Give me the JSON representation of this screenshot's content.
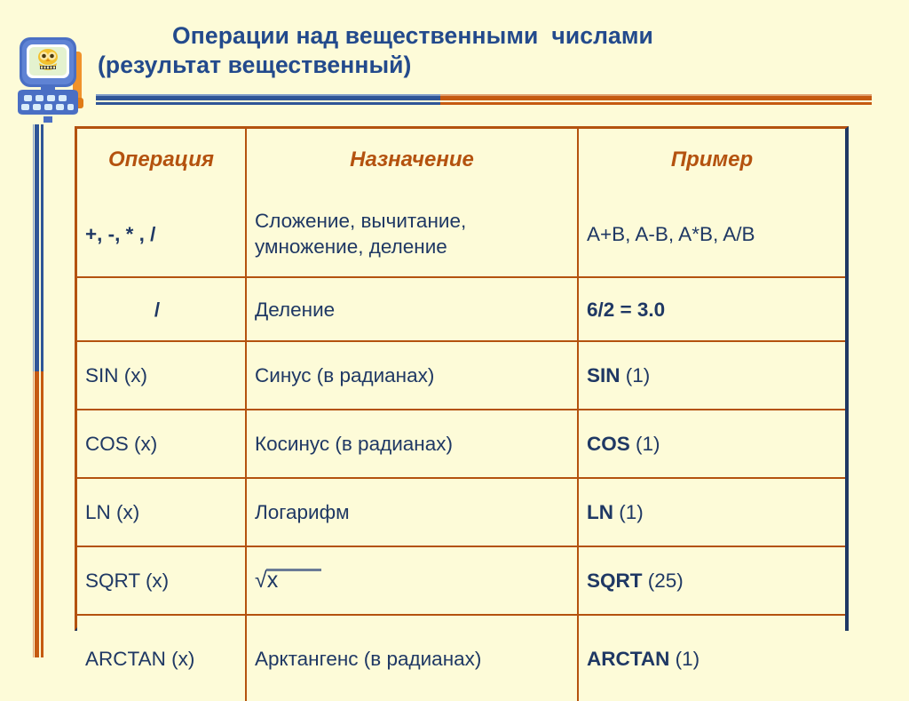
{
  "slide": {
    "background_color": "#fdfbd8",
    "title_color": "#234a8c",
    "accent_orange": "#c55a11",
    "accent_blue": "#2f5597",
    "header_text_color": "#b4520f",
    "body_text_color": "#1f3864"
  },
  "title": {
    "line1": "Операции над вещественными  числами",
    "line2": "(результат вещественный)"
  },
  "icon": {
    "name": "computer-owl-icon",
    "description": "blue computer monitor with owl on screen"
  },
  "table": {
    "headers": [
      "Операция",
      "Назначение",
      "Пример"
    ],
    "rows": [
      {
        "operation": "+, -, * , /",
        "operation_bold": true,
        "operation_align": "left",
        "purpose": "Сложение, вычитание, умножение, деление",
        "example_fn": "A+B, A-B, A*B, A/B",
        "example_arg": "",
        "example_bold": false
      },
      {
        "operation": "/",
        "operation_bold": true,
        "operation_align": "center",
        "purpose": "Деление",
        "example_fn": "6/2 = 3.0",
        "example_arg": "",
        "example_bold": true
      },
      {
        "operation": "SIN (x)",
        "operation_bold": false,
        "operation_align": "left",
        "purpose": "Синус (в радианах)",
        "example_fn": "SIN",
        "example_arg": " (1)",
        "example_bold": false
      },
      {
        "operation": "COS (x)",
        "operation_bold": false,
        "operation_align": "left",
        "purpose": "Косинус (в радианах)",
        "example_fn": "COS",
        "example_arg": " (1)",
        "example_bold": false
      },
      {
        "operation": "LN (x)",
        "operation_bold": false,
        "operation_align": "left",
        "purpose": "Логарифм",
        "example_fn": "LN",
        "example_arg": " (1)",
        "example_bold": false
      },
      {
        "operation": "SQRT (x)",
        "operation_bold": false,
        "operation_align": "left",
        "purpose_radical": "√x",
        "purpose": "",
        "example_fn": "SQRT",
        "example_arg": " (25)",
        "example_bold": false
      },
      {
        "operation": "ARCTAN (x)",
        "operation_bold": false,
        "operation_align": "left",
        "purpose": "Арктангенс (в радианах)",
        "example_fn": "ARCTAN",
        "example_arg": " (1)",
        "example_bold": false
      }
    ]
  }
}
